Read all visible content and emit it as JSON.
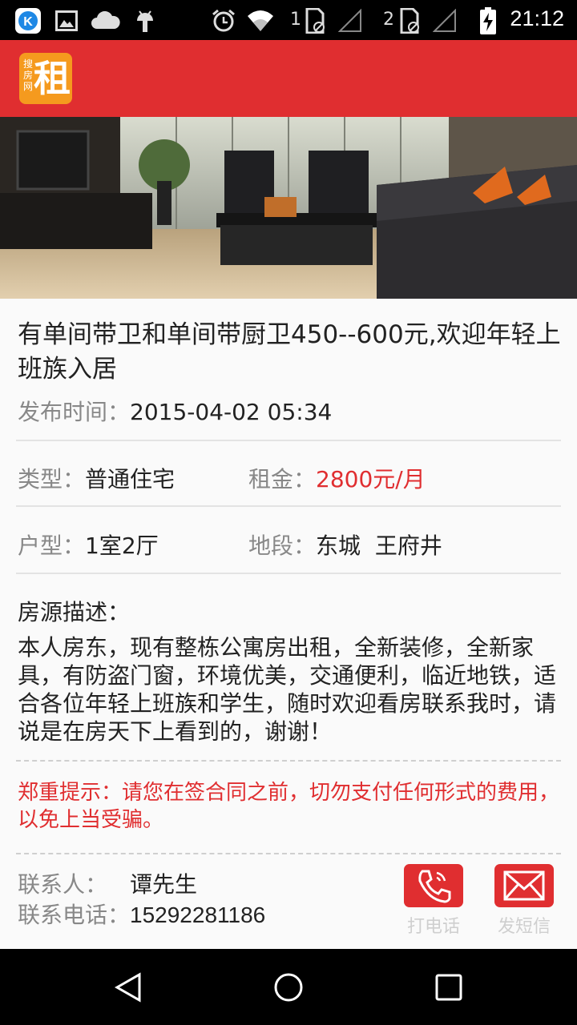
{
  "status_bar": {
    "time": "21:12",
    "sim1_label": "1",
    "sim2_label": "2",
    "icons": [
      "kuaiya-app-icon",
      "image-icon",
      "cloud-icon",
      "android-icon",
      "alarm-icon",
      "wifi-icon",
      "sim1-icon",
      "signal-icon",
      "sim2-icon",
      "signal-icon",
      "battery-charging-icon"
    ]
  },
  "app_bar": {
    "logo_small_text": "搜房网",
    "logo_big_text": "租",
    "color": "#e02e30"
  },
  "listing": {
    "title": "有单间带卫和单间带厨卫450--600元,欢迎年轻上班族入居",
    "publish_label": "发布时间：",
    "publish_time": "2015-04-02 05:34",
    "type_label": "类型：",
    "type_value": "普通住宅",
    "rent_label": "租金：",
    "rent_value": "2800元/月",
    "layout_label": "户型：",
    "layout_value": "1室2厅",
    "area_label": "地段：",
    "area_value": "东城  王府井",
    "desc_label": "房源描述：",
    "description": "本人房东，现有整栋公寓房出租，全新装修，全新家具，有防盗门窗，环境优美，交通便利，临近地铁，适合各位年轻上班族和学生，随时欢迎看房联系我时，请说是在房天下上看到的，谢谢！",
    "warning": "郑重提示：请您在签合同之前，切勿支付任何形式的费用，以免上当受骗。"
  },
  "contact": {
    "person_label": "联系人：",
    "person_value": "谭先生",
    "phone_label": "联系电话：",
    "phone_value": "15292281186",
    "call_label": "打电话",
    "sms_label": "发短信"
  },
  "nav_bar": {
    "icons": [
      "back-icon",
      "home-icon",
      "recents-icon"
    ]
  }
}
